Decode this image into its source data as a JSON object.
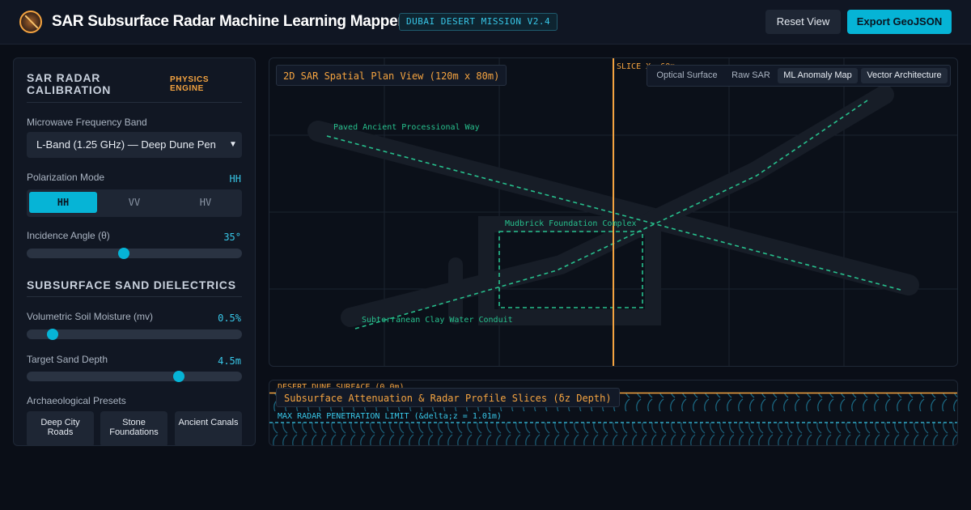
{
  "header": {
    "title": "SAR Subsurface Radar Machine Learning Mapper",
    "mission_badge": "DUBAI DESERT MISSION V2.4",
    "reset_label": "Reset View",
    "export_label": "Export GeoJSON",
    "logo_icon": "radar-sweep-icon"
  },
  "sidebar": {
    "calibration": {
      "title": "SAR RADAR CALIBRATION",
      "tag": "PHYSICS ENGINE",
      "frequency_label": "Microwave Frequency Band",
      "frequency_value": "L-Band (1.25 GHz) — Deep Dune Pen",
      "polarization_label": "Polarization Mode",
      "polarization_value": "HH",
      "polarization_options": [
        "HH",
        "VV",
        "HV"
      ],
      "polarization_selected": "HH",
      "incidence_label": "Incidence Angle (θ)",
      "incidence_value": "35°",
      "incidence_fraction": 0.45
    },
    "dielectrics": {
      "title": "SUBSURFACE SAND DIELECTRICS",
      "moisture_label": "Volumetric Soil Moisture (mv)",
      "moisture_value": "0.5%",
      "moisture_fraction": 0.12,
      "depth_label": "Target Sand Depth",
      "depth_value": "4.5m",
      "depth_fraction": 0.705,
      "presets_label": "Archaeological Presets",
      "presets": [
        "Deep City Roads",
        "Stone Foundations",
        "Ancient Canals"
      ]
    }
  },
  "map": {
    "title": "2D SAR Spatial Plan View (120m x 80m)",
    "slice_label": "SLICE X: 60m",
    "view_tabs": [
      "Optical Surface",
      "Raw SAR",
      "ML Anomaly Map",
      "Vector Architecture"
    ],
    "active_tabs": [
      "ML Anomaly Map",
      "Vector Architecture"
    ],
    "features": {
      "road": "Paved Ancient Processional Way",
      "foundation": "Mudbrick Foundation Complex",
      "conduit": "Subterranean Clay Water Conduit"
    },
    "colors": {
      "accent": "#06b4d6",
      "slice": "#f4a340",
      "vector": "#27c08d"
    }
  },
  "profile": {
    "title": "Subsurface Attenuation & Radar Profile Slices (δz Depth)",
    "surface_label": "DESERT DUNE SURFACE (0.0m)",
    "limit_label": "MAX RADAR PENETRATION LIMIT (&delta;z = 1.01m)"
  }
}
